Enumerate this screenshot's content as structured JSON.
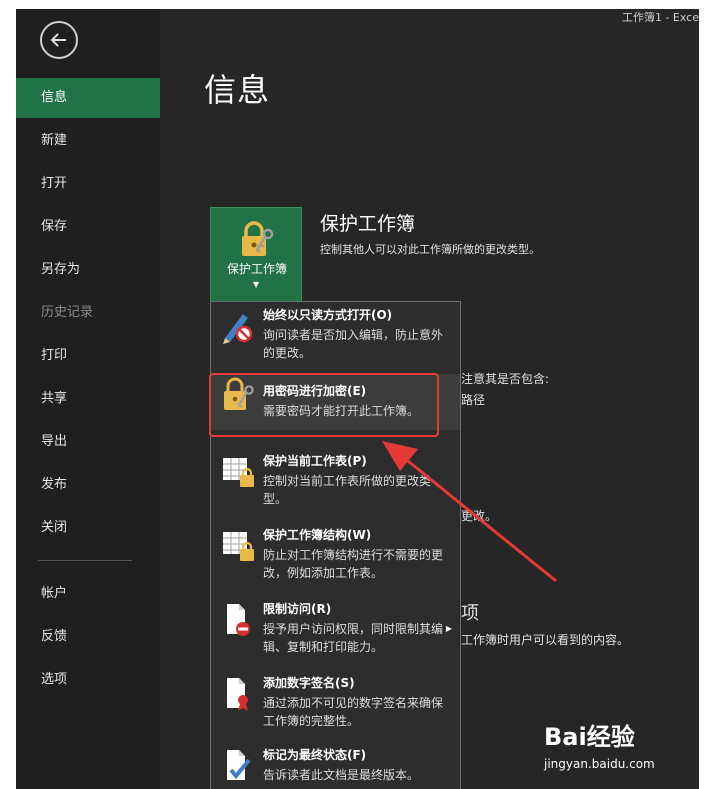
{
  "window": {
    "title_fragment": "工作簿1 - Exce"
  },
  "sidebar": {
    "items": [
      {
        "label": "信息"
      },
      {
        "label": "新建"
      },
      {
        "label": "打开"
      },
      {
        "label": "保存"
      },
      {
        "label": "另存为"
      },
      {
        "label": "历史记录"
      },
      {
        "label": "打印"
      },
      {
        "label": "共享"
      },
      {
        "label": "导出"
      },
      {
        "label": "发布"
      },
      {
        "label": "关闭"
      },
      {
        "label": "帐户"
      },
      {
        "label": "反馈"
      },
      {
        "label": "选项"
      }
    ]
  },
  "main": {
    "title": "信息",
    "protect": {
      "button_label": "保护工作簿",
      "heading": "保护工作簿",
      "description": "控制其他人可以对此工作簿所做的更改类型。"
    },
    "background_fragments": {
      "inspect_1": "注意其是否包含:",
      "inspect_2": "路径",
      "versions": "更改。",
      "browser_title": "项",
      "browser_desc": "工作簿时用户可以看到的内容。"
    }
  },
  "menu": {
    "items": [
      {
        "title": "始终以只读方式打开(O)",
        "desc": "询问读者是否加入编辑，防止意外的更改。",
        "icon": "pencil-no-icon"
      },
      {
        "title": "用密码进行加密(E)",
        "desc": "需要密码才能打开此工作簿。",
        "icon": "lock-key-icon"
      },
      {
        "title": "保护当前工作表(P)",
        "desc": "控制对当前工作表所做的更改类型。",
        "icon": "sheet-lock-icon"
      },
      {
        "title": "保护工作簿结构(W)",
        "desc": "防止对工作簿结构进行不需要的更改，例如添加工作表。",
        "icon": "workbook-lock-icon"
      },
      {
        "title": "限制访问(R)",
        "desc": "授予用户访问权限，同时限制其编辑、复制和打印能力。",
        "icon": "restrict-access-icon"
      },
      {
        "title": "添加数字签名(S)",
        "desc": "通过添加不可见的数字签名来确保工作簿的完整性。",
        "icon": "signature-icon"
      },
      {
        "title": "标记为最终状态(F)",
        "desc": "告诉读者此文档是最终版本。",
        "icon": "mark-final-icon"
      }
    ]
  },
  "watermark": {
    "brand": "Bai经验",
    "url": "jingyan.baidu.com"
  },
  "colors": {
    "accent": "#217346",
    "highlight": "#e53935",
    "background": "#262626"
  }
}
